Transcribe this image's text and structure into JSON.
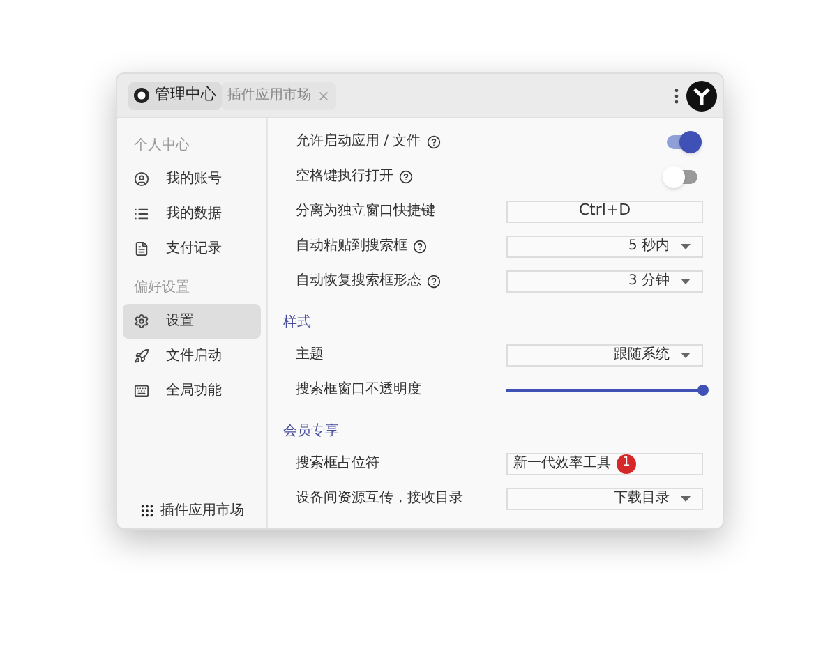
{
  "tabs": [
    {
      "label": "管理中心",
      "selected": true,
      "closable": false
    },
    {
      "label": "插件应用市场",
      "selected": false,
      "closable": true
    }
  ],
  "sidebar": {
    "groups": [
      {
        "title": "个人中心",
        "items": [
          {
            "label": "我的账号",
            "selected": false
          },
          {
            "label": "我的数据",
            "selected": false
          },
          {
            "label": "支付记录",
            "selected": false
          }
        ]
      },
      {
        "title": "偏好设置",
        "items": [
          {
            "label": "设置",
            "selected": true
          },
          {
            "label": "文件启动",
            "selected": false
          },
          {
            "label": "全局功能",
            "selected": false
          }
        ]
      }
    ],
    "footer": "插件应用市场"
  },
  "sections": [
    {
      "rows": [
        {
          "kind": "toggle",
          "label": "允许启动应用 / 文件",
          "help": true,
          "on": true
        },
        {
          "kind": "toggle",
          "label": "空格键执行打开",
          "help": true,
          "on": false
        },
        {
          "kind": "key",
          "label": "分离为独立窗口快捷键",
          "help": false,
          "value": "Ctrl+D"
        },
        {
          "kind": "select",
          "label": "自动粘贴到搜索框",
          "help": true,
          "value": "5 秒内"
        },
        {
          "kind": "select",
          "label": "自动恢复搜索框形态",
          "help": true,
          "value": "3 分钟"
        }
      ]
    },
    {
      "title": "样式",
      "rows": [
        {
          "kind": "select",
          "label": "主题",
          "help": false,
          "value": "跟随系统"
        },
        {
          "kind": "slider",
          "label": "搜索框窗口不透明度",
          "help": false,
          "level": 1
        }
      ]
    },
    {
      "title": "会员专享",
      "rows": [
        {
          "kind": "text",
          "label": "搜索框占位符",
          "help": false,
          "value": "新一代效率工具",
          "badge": "1"
        },
        {
          "kind": "select",
          "label": "设备间资源互传，接收目录",
          "help": false,
          "value": "下载目录"
        }
      ]
    }
  ]
}
